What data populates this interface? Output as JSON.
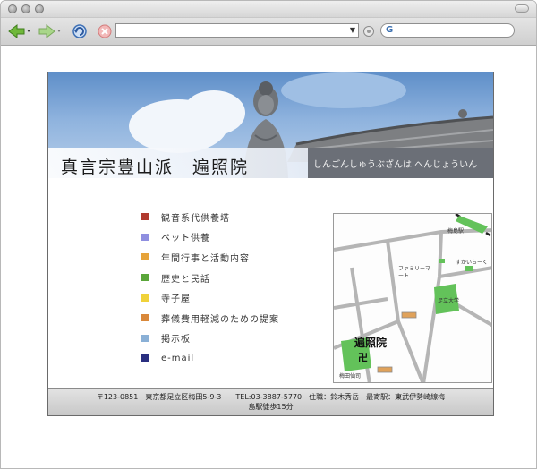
{
  "browser": {
    "url": "",
    "search_hint": "G"
  },
  "site": {
    "title": "真言宗豊山派　遍照院",
    "subtitle": "しんごんしゅうぶざんは へんじょういん",
    "menu": [
      {
        "label": "観音系代供養塔",
        "color": "#b03a2e"
      },
      {
        "label": "ペット供養",
        "color": "#8f8fe0"
      },
      {
        "label": "年間行事と活動内容",
        "color": "#e6a33a"
      },
      {
        "label": "歴史と民話",
        "color": "#5aa63a"
      },
      {
        "label": "寺子屋",
        "color": "#f0d23a"
      },
      {
        "label": "葬儀費用軽減のための提案",
        "color": "#d9883a"
      },
      {
        "label": "掲示板",
        "color": "#8ab0d6"
      },
      {
        "label": "e-mail",
        "color": "#2a2f80"
      }
    ],
    "map": {
      "station_top": "梅島駅",
      "family_mart": "ファミリーマート",
      "sukairaku": "すかいらーく",
      "school": "足立大学",
      "temple": "遍照院",
      "temple_mark": "卍",
      "bottom_label": "梅田仙司"
    },
    "footer": {
      "line1": "〒123-0851　東京都足立区梅田5-9-3　　TEL:03-3887-5770　住職：鈴木秀岳　最寄駅：東武伊勢崎線梅",
      "line2": "島駅徒歩15分"
    }
  }
}
